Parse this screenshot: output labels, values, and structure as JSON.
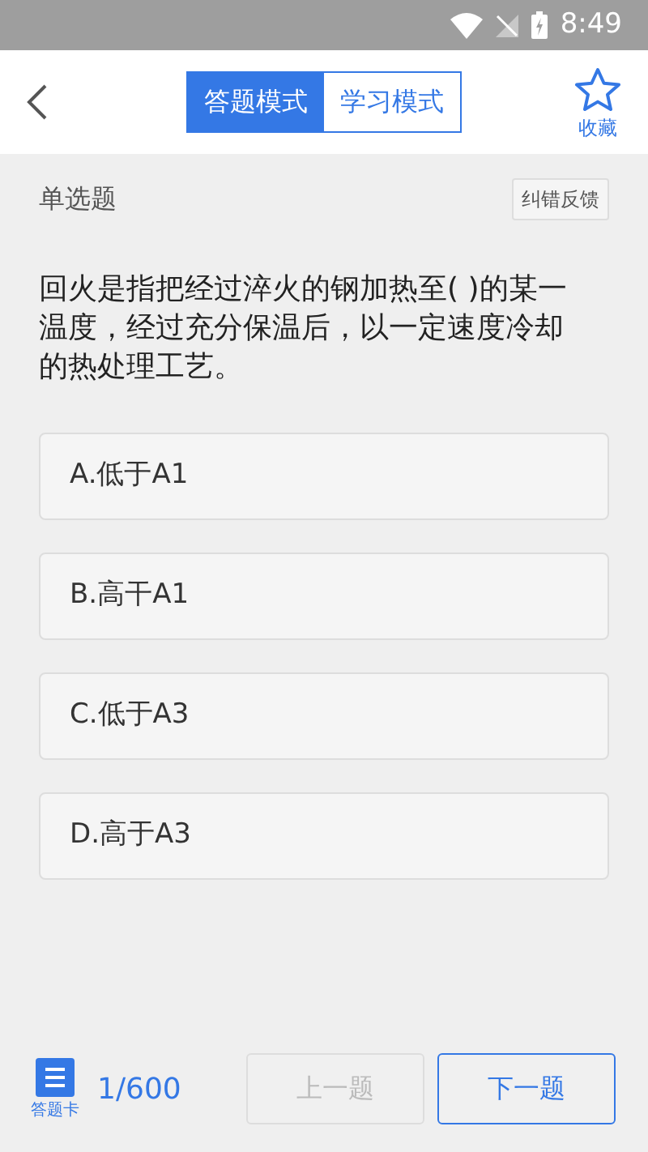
{
  "status_bar": {
    "time": "8:49"
  },
  "header": {
    "modes": [
      {
        "label": "答题模式",
        "selected": true
      },
      {
        "label": "学习模式",
        "selected": false
      }
    ],
    "favorite": {
      "label": "收藏",
      "on": false
    }
  },
  "question": {
    "type": "单选题",
    "feedback_button": "纠错反馈",
    "text": "回火是指把经过淬火的钢加热至( )的某一温度，经过充分保温后，以一定速度冷却的热处理工艺。",
    "options": [
      {
        "label": "A.低于A1",
        "selected": false
      },
      {
        "label": "B.高干A1",
        "selected": false
      },
      {
        "label": "C.低于A3",
        "selected": false
      },
      {
        "label": "D.高于A3",
        "selected": false
      }
    ]
  },
  "footer": {
    "card_label": "答题卡",
    "progress": "1/600",
    "buttons": [
      {
        "label": "上一题",
        "disabled": true
      },
      {
        "label": "下一题",
        "disabled": false
      }
    ]
  }
}
